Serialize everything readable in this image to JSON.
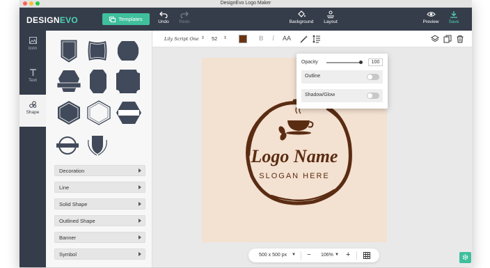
{
  "window": {
    "title": "DesignEvo Logo Maker"
  },
  "topbar": {
    "logo_part1": "DESIGN",
    "logo_part2": "EVO",
    "templates_label": "Templates",
    "undo_label": "Undo",
    "redo_label": "Redo",
    "background_label": "Background",
    "layout_label": "Layout",
    "preview_label": "Preview",
    "save_label": "Save"
  },
  "sidebar": {
    "tabs": [
      {
        "label": "Icon",
        "icon": "image-icon"
      },
      {
        "label": "Text",
        "icon": "text-t-icon"
      },
      {
        "label": "Shape",
        "icon": "shapes-icon",
        "active": true
      }
    ]
  },
  "categories": [
    "Decoration",
    "Line",
    "Solid Shape",
    "Outlined Shape",
    "Banner",
    "Symbol"
  ],
  "editbar": {
    "font_name": "Lily Script One",
    "font_size": "52",
    "text_color": "#6b3410",
    "bold_label": "B",
    "italic_label": "I",
    "case_label": "AA"
  },
  "canvas": {
    "background": "#f3e1d1",
    "logo_name": "Logo Name",
    "slogan": "SLOGAN HERE",
    "ink_color": "#5a2c12"
  },
  "popup": {
    "opacity_label": "Opacity",
    "opacity_value": "100",
    "opacity_fraction": 1.0,
    "outline_label": "Outline",
    "outline_on": false,
    "shadow_label": "Shadow/Glow",
    "shadow_on": false
  },
  "zoombar": {
    "size_label": "500 x 500 px",
    "zoom_label": "106%",
    "minus_label": "−",
    "plus_label": "+"
  },
  "colors": {
    "accent": "#3fbf9c",
    "dark": "#353c4a"
  }
}
